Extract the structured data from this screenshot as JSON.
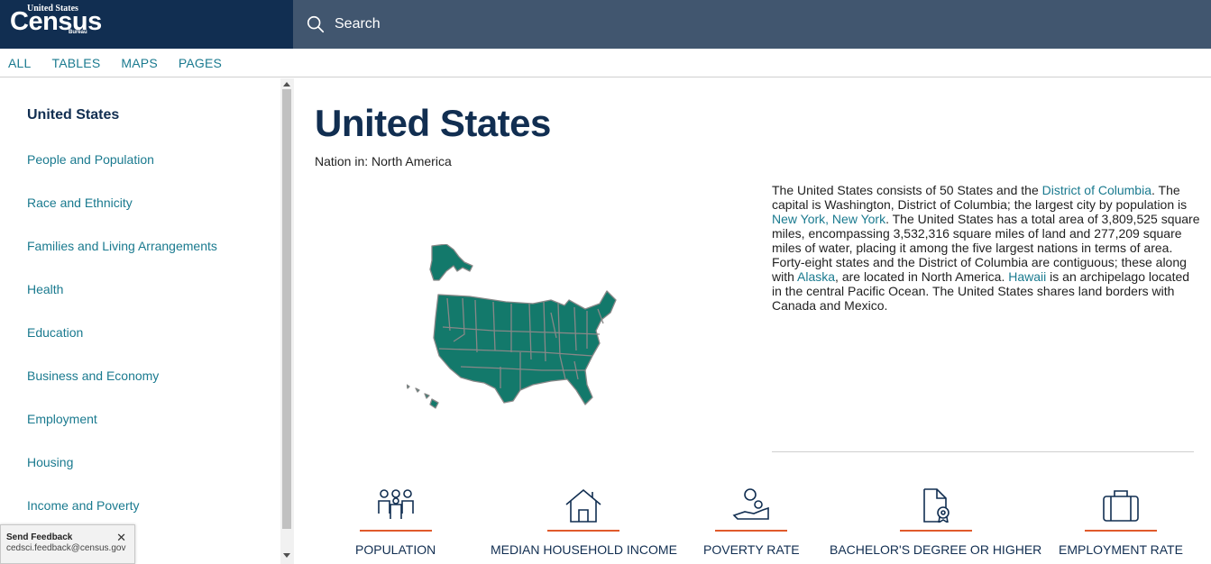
{
  "header": {
    "logo": {
      "line1": "United States",
      "line2": "Census",
      "line3": "Bureau"
    },
    "search_placeholder": "Search"
  },
  "tabs": [
    "ALL",
    "TABLES",
    "MAPS",
    "PAGES"
  ],
  "sidebar": {
    "items": [
      {
        "label": "United States",
        "active": true
      },
      {
        "label": "People and Population"
      },
      {
        "label": "Race and Ethnicity"
      },
      {
        "label": "Families and Living Arrangements"
      },
      {
        "label": "Health"
      },
      {
        "label": "Education"
      },
      {
        "label": "Business and Economy"
      },
      {
        "label": "Employment"
      },
      {
        "label": "Housing"
      },
      {
        "label": "Income and Poverty"
      }
    ]
  },
  "feedback": {
    "title": "Send Feedback",
    "email": "cedsci.feedback@census.gov",
    "close": "✕"
  },
  "main": {
    "title": "United States",
    "nation": "Nation in: North America",
    "description": {
      "p1": "The United States consists of 50 States and the ",
      "link1": "District of Columbia",
      "p2": ". The capital is Washington, District of Columbia; the largest city by population is ",
      "link2": "New York, New York",
      "p3": ". The United States has a total area of 3,809,525 square miles, encompassing 3,532,316 square miles of land and 277,209 square miles of water, placing it among the five largest nations in terms of area. Forty-eight states and the District of Columbia are contiguous; these along with ",
      "link3": "Alaska",
      "p4": ", are located in North America. ",
      "link4": "Hawaii",
      "p5": " is an archipelago located in the central Pacific Ocean. The United States shares land borders with Canada and Mexico."
    },
    "stats": [
      {
        "label": "POPULATION",
        "icon": "people-icon"
      },
      {
        "label": "MEDIAN HOUSEHOLD INCOME",
        "icon": "house-icon"
      },
      {
        "label": "POVERTY RATE",
        "icon": "hand-coins-icon"
      },
      {
        "label": "BACHELOR'S DEGREE OR HIGHER",
        "icon": "certificate-icon"
      },
      {
        "label": "EMPLOYMENT RATE",
        "icon": "briefcase-icon"
      }
    ]
  },
  "colors": {
    "navy": "#112e51",
    "slate": "#41566f",
    "teal": "#1a7a8f",
    "map": "#13796b",
    "accent": "#e05a2b"
  }
}
